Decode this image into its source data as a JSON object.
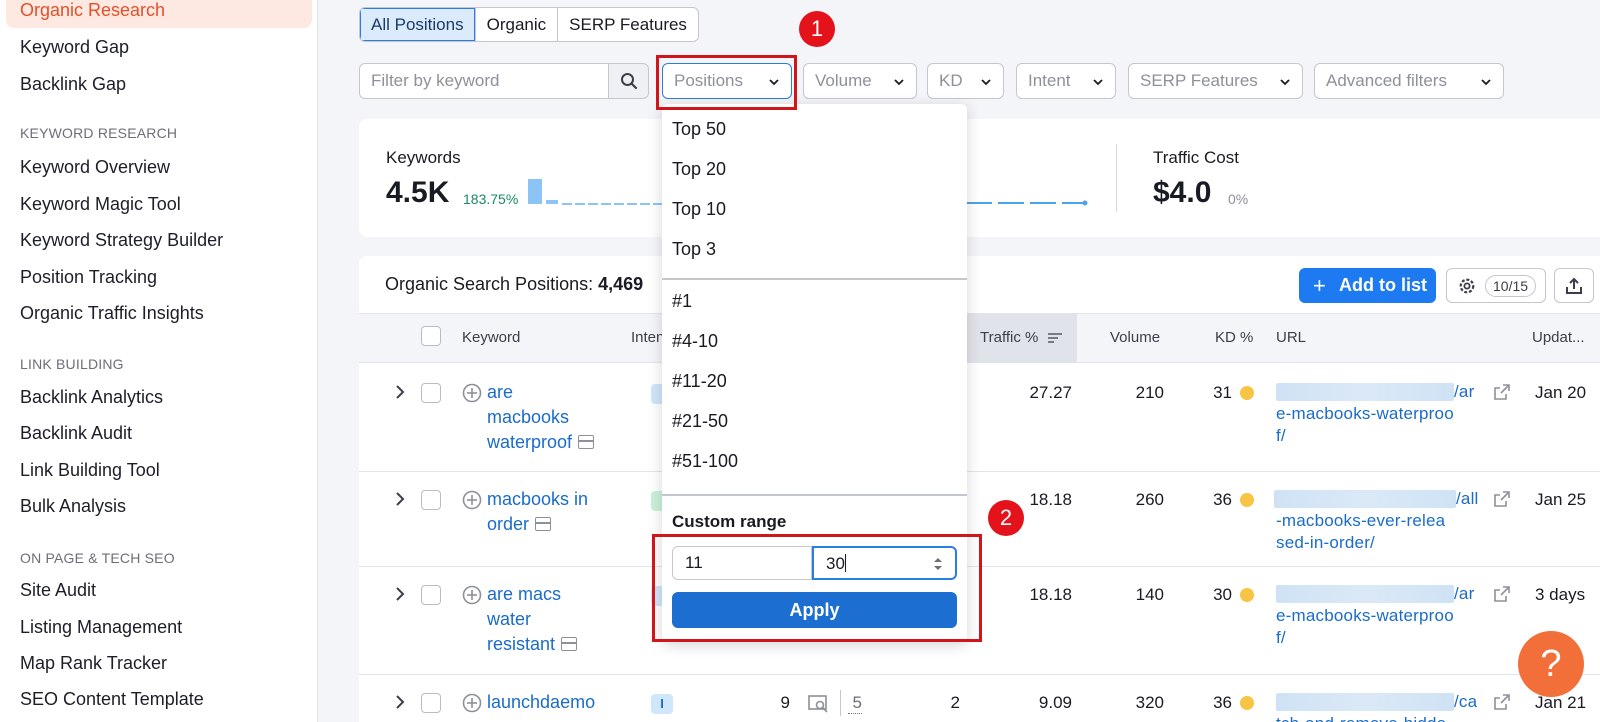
{
  "sidebar": {
    "active_item": "Organic Research",
    "items_top": [
      "Keyword Gap",
      "Backlink Gap"
    ],
    "sections": [
      {
        "title": "KEYWORD RESEARCH",
        "items": [
          "Keyword Overview",
          "Keyword Magic Tool",
          "Keyword Strategy Builder",
          "Position Tracking",
          "Organic Traffic Insights"
        ]
      },
      {
        "title": "LINK BUILDING",
        "items": [
          "Backlink Analytics",
          "Backlink Audit",
          "Link Building Tool",
          "Bulk Analysis"
        ]
      },
      {
        "title": "ON PAGE & TECH SEO",
        "items": [
          "Site Audit",
          "Listing Management",
          "Map Rank Tracker",
          "SEO Content Template"
        ]
      }
    ]
  },
  "tabs": [
    "All Positions",
    "Organic",
    "SERP Features"
  ],
  "filters": {
    "keyword_placeholder": "Filter by keyword",
    "positions": "Positions",
    "volume": "Volume",
    "kd": "KD",
    "intent": "Intent",
    "serp_features": "SERP Features",
    "advanced": "Advanced filters"
  },
  "overview": {
    "keywords_label": "Keywords",
    "keywords_value": "4.5K",
    "keywords_change": "183.75%",
    "traffic_cost_label": "Traffic Cost",
    "traffic_cost_value": "$4.0",
    "traffic_cost_change": "0%"
  },
  "table": {
    "title_prefix": "Organic Search Positions: ",
    "title_count": "4,469",
    "add_button": "Add to list",
    "columns_count": "10/15",
    "headers": {
      "keyword": "Keyword",
      "intent": "Inten",
      "traffic": "Traffic %",
      "volume": "Volume",
      "kd": "KD %",
      "url": "URL",
      "updated": "Updat..."
    },
    "rows": [
      {
        "kw_lines": [
          "are",
          "macbooks",
          "waterproof"
        ],
        "intent": "",
        "traffic": "27.27",
        "volume": "210",
        "kd": "31",
        "url_lines": [
          "/ar",
          "e-macbooks-waterproo",
          "f/"
        ],
        "date": "Jan 20"
      },
      {
        "kw_lines": [
          "macbooks in",
          "order"
        ],
        "intent": "",
        "traffic": "18.18",
        "volume": "260",
        "kd": "36",
        "url_lines": [
          "/all",
          "-macbooks-ever-relea",
          "sed-in-order/"
        ],
        "date": "Jan 25"
      },
      {
        "kw_lines": [
          "are macs",
          "water",
          "resistant"
        ],
        "intent": "",
        "traffic": "18.18",
        "volume": "140",
        "kd": "30",
        "url_lines": [
          "/ar",
          "e-macbooks-waterproo",
          "f/"
        ],
        "date": "3 days"
      },
      {
        "kw_lines": [
          "launchdaemo"
        ],
        "intent": "I",
        "pos": "9",
        "pos_prev": "5",
        "diff": "2",
        "traffic": "9.09",
        "volume": "320",
        "kd": "36",
        "url_lines": [
          "/ca",
          "tch-and-remove-hidde"
        ],
        "date": "Jan 21"
      }
    ]
  },
  "positions_menu": {
    "tops": [
      "Top 50",
      "Top 20",
      "Top 10",
      "Top 3"
    ],
    "ranges": [
      "#1",
      "#4-10",
      "#11-20",
      "#21-50",
      "#51-100"
    ],
    "custom_label": "Custom range",
    "from_value": "11",
    "to_value": "30",
    "apply": "Apply"
  },
  "annotations": [
    "1",
    "2"
  ],
  "help_label": "?",
  "colors": {
    "accent": "#1d7af1",
    "annotation": "#d0151b",
    "active_nav": "#e3502a",
    "help": "#f36f3a"
  }
}
